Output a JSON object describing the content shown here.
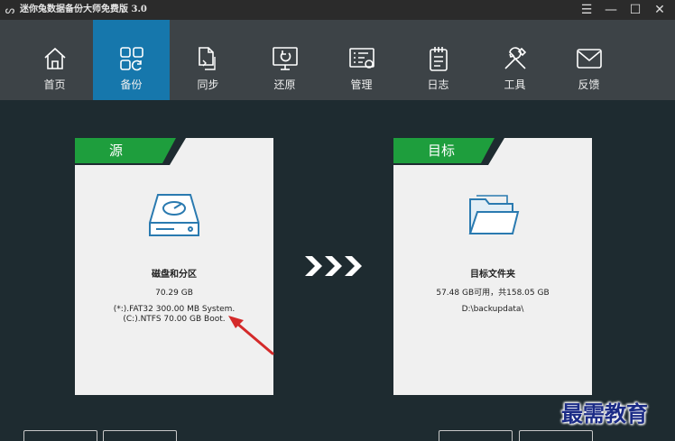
{
  "window": {
    "title": "迷你兔数据备份大师免费版 3.0",
    "controls": [
      "☰",
      "—",
      "☐",
      "✕"
    ]
  },
  "nav": {
    "items": [
      {
        "label": "首页",
        "icon": "home-icon"
      },
      {
        "label": "备份",
        "icon": "backup-grid-icon",
        "active": true
      },
      {
        "label": "同步",
        "icon": "sync-file-icon"
      },
      {
        "label": "还原",
        "icon": "restore-monitor-icon"
      },
      {
        "label": "管理",
        "icon": "manage-list-icon"
      },
      {
        "label": "日志",
        "icon": "log-notepad-icon"
      },
      {
        "label": "工具",
        "icon": "tools-icon"
      },
      {
        "label": "反馈",
        "icon": "feedback-mail-icon"
      }
    ]
  },
  "source": {
    "header": "源",
    "name": "磁盘和分区",
    "size": "70.29 GB",
    "partitions": [
      "(*:).FAT32 300.00 MB System.",
      "(C:).NTFS 70.00 GB Boot."
    ]
  },
  "target": {
    "header": "目标",
    "name": "目标文件夹",
    "capacity": "57.48 GB可用，共158.05 GB",
    "path": "D:\\backupdata\\"
  },
  "watermark": "最需教育",
  "colors": {
    "accent": "#1677ac",
    "header_green": "#1e9e3d",
    "background": "#1e2b30",
    "toolbar": "#3d4347",
    "icon_blue": "#2a7ab0",
    "annotation": "#d42a2a"
  }
}
